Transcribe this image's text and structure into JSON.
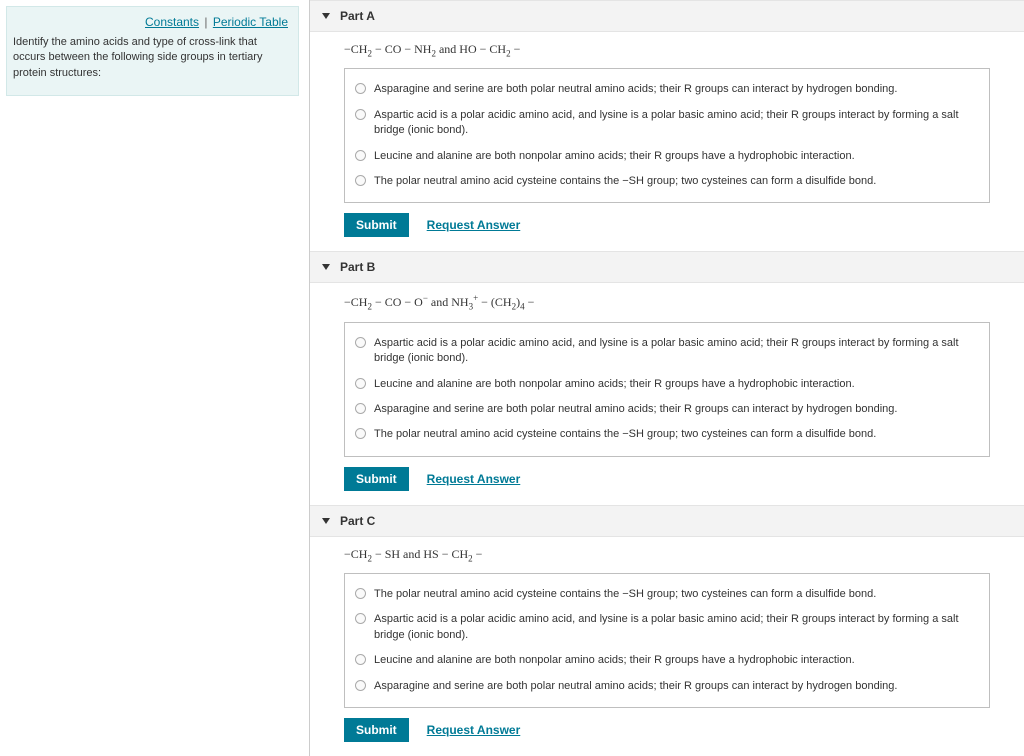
{
  "sidebar": {
    "constants_link": "Constants",
    "periodic_link": "Periodic Table",
    "prompt": "Identify the amino acids and type of cross-link that occurs between the following side groups in tertiary protein structures:"
  },
  "parts": {
    "a": {
      "title": "Part A",
      "formula_html": "−CH<sub>2</sub> − CO − NH<sub>2</sub> and HO − CH<sub>2</sub> −",
      "options": [
        "Asparagine and serine are both polar neutral amino acids; their R groups can interact by hydrogen bonding.",
        "Aspartic acid is a polar acidic amino acid, and lysine is a polar basic amino acid; their R groups interact by forming a salt bridge (ionic bond).",
        "Leucine and alanine are both nonpolar amino acids; their R groups have a hydrophobic interaction.",
        "The polar neutral amino acid cysteine contains the −SH group; two cysteines can form a disulfide bond."
      ]
    },
    "b": {
      "title": "Part B",
      "formula_html": "−CH<sub>2</sub> − CO − O<sup>−</sup> and NH<sub>3</sub><sup>+</sup> − (CH<sub>2</sub>)<sub>4</sub> −",
      "options": [
        "Aspartic acid is a polar acidic amino acid, and lysine is a polar basic amino acid; their R groups interact by forming a salt bridge (ionic bond).",
        "Leucine and alanine are both nonpolar amino acids; their R groups have a hydrophobic interaction.",
        "Asparagine and serine are both polar neutral amino acids; their R groups can interact by hydrogen bonding.",
        "The polar neutral amino acid cysteine contains the −SH group; two cysteines can form a disulfide bond."
      ]
    },
    "c": {
      "title": "Part C",
      "formula_html": "−CH<sub>2</sub> − SH and HS − CH<sub>2</sub> −",
      "options": [
        "The polar neutral amino acid cysteine contains the −SH group; two cysteines can form a disulfide bond.",
        "Aspartic acid is a polar acidic amino acid, and lysine is a polar basic amino acid; their R groups interact by forming a salt bridge (ionic bond).",
        "Leucine and alanine are both nonpolar amino acids; their R groups have a hydrophobic interaction.",
        "Asparagine and serine are both polar neutral amino acids; their R groups can interact by hydrogen bonding."
      ]
    }
  },
  "buttons": {
    "submit": "Submit",
    "request": "Request Answer"
  }
}
